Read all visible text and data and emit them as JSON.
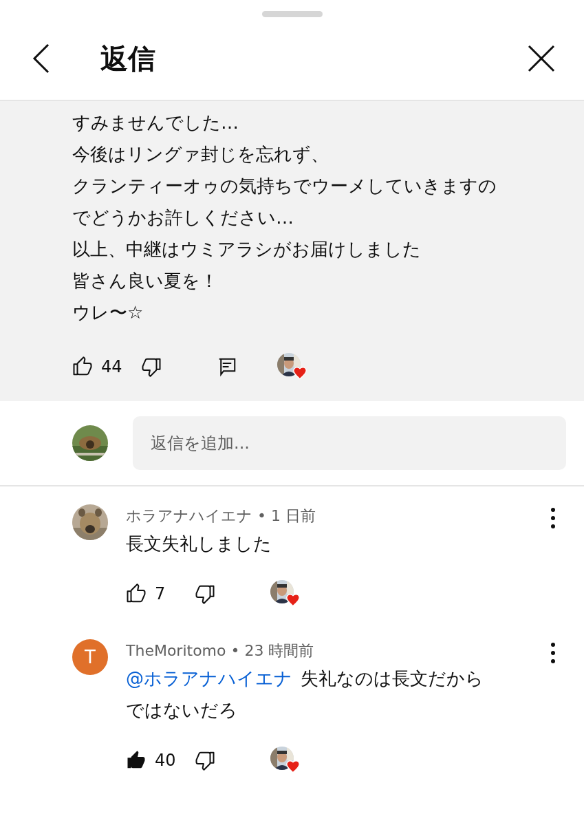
{
  "header": {
    "title": "返信"
  },
  "comment": {
    "lines": [
      "すみませんでした…",
      "今後はリングァ封じを忘れず、",
      "クランティーオゥの気持ちでウーメしていきますの",
      "でどうかお許しください…",
      "以上、中継はウミアラシがお届けしました",
      "皆さん良い夏を！",
      "ウレ〜☆"
    ],
    "likes": "44",
    "liked": false,
    "creator_heart": true
  },
  "reply_box": {
    "placeholder": "返信を追加..."
  },
  "replies": [
    {
      "meta": "ホラアナハイエナ • 1 日前",
      "text": "長文失礼しました",
      "likes": "7",
      "liked": false,
      "creator_heart": true
    },
    {
      "avatar": {
        "kind": "letter",
        "letter": "T"
      },
      "meta": "TheMoritomo • 23 時間前",
      "mention": "@ホラアナハイエナ",
      "text": "失礼なのは長文だからではないだろ",
      "likes": "40",
      "liked": true,
      "creator_heart": true
    }
  ]
}
